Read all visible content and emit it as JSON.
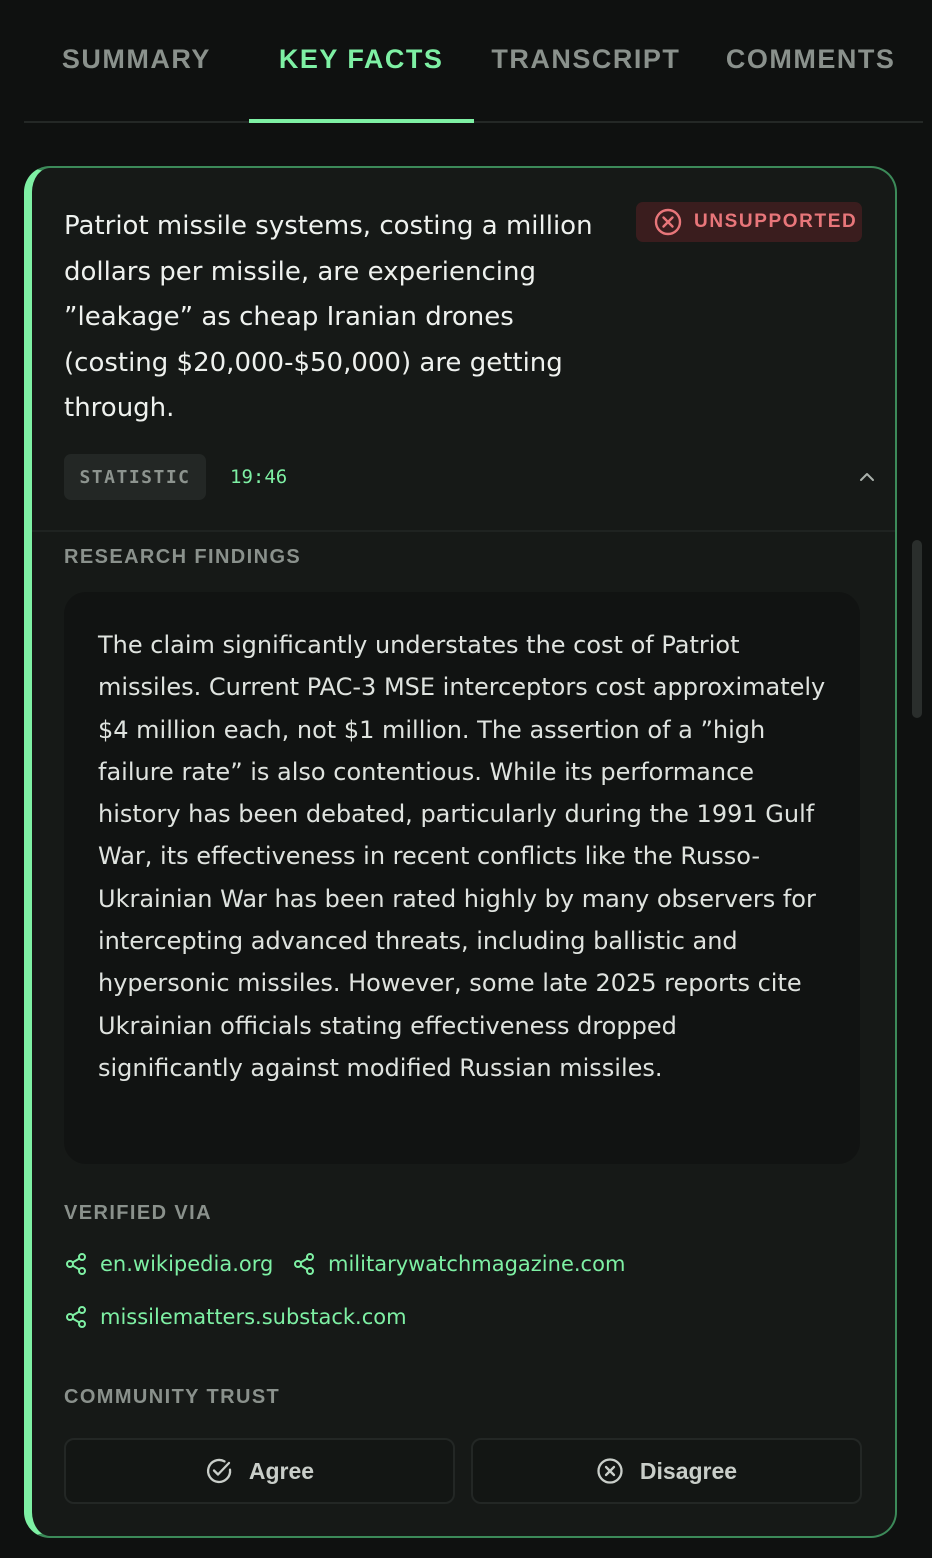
{
  "tabs": [
    {
      "label": "SUMMARY",
      "active": false
    },
    {
      "label": "KEY FACTS",
      "active": true
    },
    {
      "label": "TRANSCRIPT",
      "active": false
    },
    {
      "label": "COMMENTS",
      "active": false
    }
  ],
  "fact": {
    "claim": "Patriot missile systems, costing a million dollars per missile, are experiencing ”leakage” as cheap Iranian drones (costing $20,000-$50,000) are getting through.",
    "status_label": "UNSUPPORTED",
    "status_icon": "x-circle-icon",
    "status_color": "#e8767a",
    "type": "STATISTIC",
    "timestamp": "19:46",
    "collapse_icon": "chevron-up-icon"
  },
  "research": {
    "title": "RESEARCH FINDINGS",
    "text": "The claim significantly understates the cost of Patriot missiles. Current PAC-3 MSE interceptors cost approximately $4 million each, not $1 million. The assertion of a ”high failure rate” is also contentious. While its performance history has been debated, particularly during the 1991 Gulf War, its effectiveness in recent conflicts like the Russo-Ukrainian War has been rated highly by many observers for intercepting advanced threats, including ballistic and hypersonic missiles. However, some late 2025 reports cite Ukrainian officials stating effectiveness dropped significantly against modified Russian missiles."
  },
  "verified": {
    "title": "VERIFIED VIA",
    "sources": [
      "en.wikipedia.org",
      "militarywatchmagazine.com",
      "missilematters.substack.com"
    ],
    "icon": "share-icon"
  },
  "community": {
    "title": "COMMUNITY TRUST",
    "agree_label": "Agree",
    "disagree_label": "Disagree"
  },
  "colors": {
    "accent": "#7ef0a4",
    "background": "#0f1110",
    "card": "#161917",
    "danger": "#e8767a"
  }
}
